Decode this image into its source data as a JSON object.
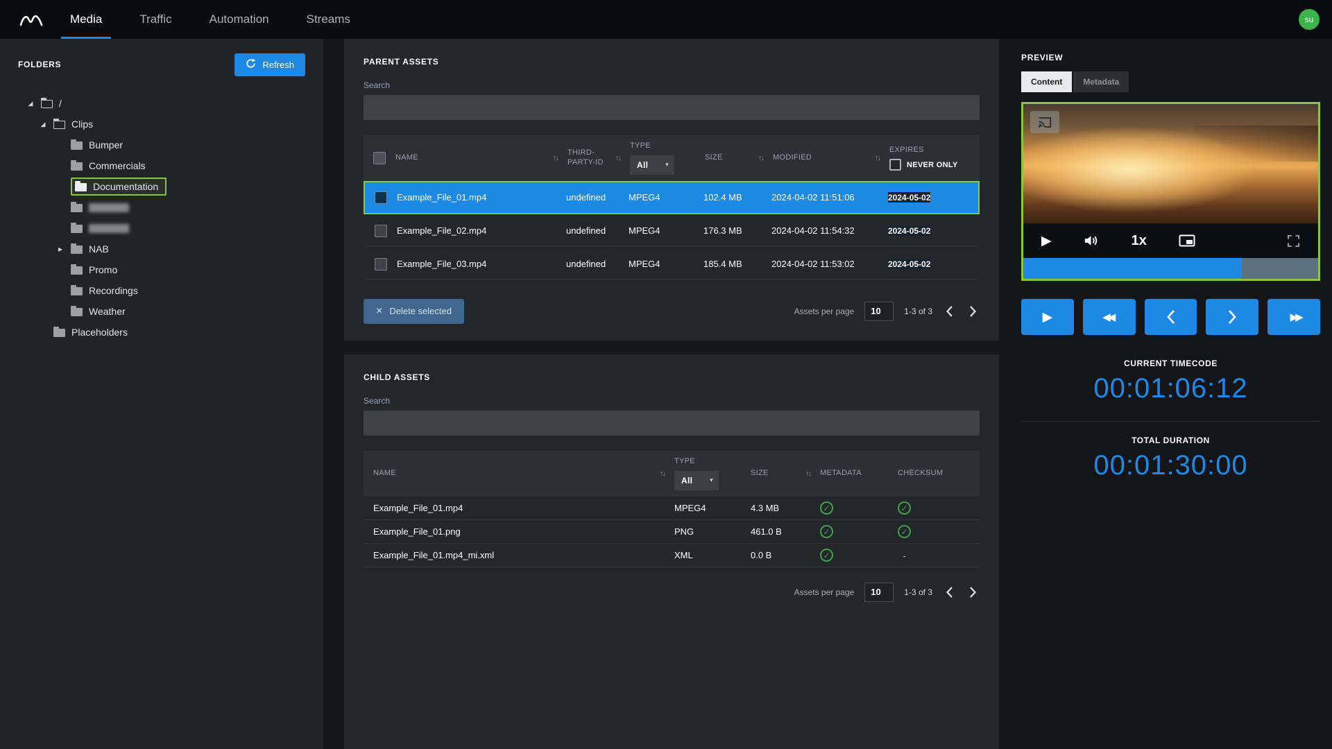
{
  "colors": {
    "accent": "#1e88e5",
    "highlight_green": "#8cc63f",
    "success_green": "#43a047",
    "avatar_green": "#3bb54a"
  },
  "icons": {
    "sort": "↑↓",
    "caret_expanded": "◢",
    "caret_collapsed": "▸",
    "select_caret": "▾",
    "close": "×",
    "play": "▶",
    "rewind": "◀◀",
    "fast_forward": "▶▶"
  },
  "nav": {
    "tabs": [
      {
        "label": "Media",
        "active": true
      },
      {
        "label": "Traffic",
        "active": false
      },
      {
        "label": "Automation",
        "active": false
      },
      {
        "label": "Streams",
        "active": false
      }
    ],
    "avatar_initials": "su"
  },
  "folders": {
    "title": "FOLDERS",
    "refresh_label": "Refresh",
    "tree": [
      {
        "label": "/",
        "level": 0,
        "state": "expanded"
      },
      {
        "label": "Clips",
        "level": 1,
        "state": "expanded"
      },
      {
        "label": "Bumper",
        "level": 2
      },
      {
        "label": "Commercials",
        "level": 2
      },
      {
        "label": "Documentation",
        "level": 2,
        "selected": true
      },
      {
        "label": "",
        "level": 2,
        "redacted": true
      },
      {
        "label": "",
        "level": 2,
        "redacted": true
      },
      {
        "label": "NAB",
        "level": 2,
        "state": "collapsed"
      },
      {
        "label": "Promo",
        "level": 2
      },
      {
        "label": "Recordings",
        "level": 2
      },
      {
        "label": "Weather",
        "level": 2
      },
      {
        "label": "Placeholders",
        "level": 1
      }
    ]
  },
  "parent_assets": {
    "title": "PARENT ASSETS",
    "search_label": "Search",
    "search_value": "",
    "columns": {
      "name": "NAME",
      "third_party_id": "THIRD-PARTY-ID",
      "type": "TYPE",
      "type_filter": "All",
      "size": "SIZE",
      "modified": "MODIFIED",
      "expires": "EXPIRES",
      "never_only": "NEVER ONLY"
    },
    "rows": [
      {
        "name": "Example_File_01.mp4",
        "third_party_id": "undefined",
        "type": "MPEG4",
        "size": "102.4 MB",
        "modified": "2024-04-02 11:51:06",
        "expires": "2024-05-02",
        "selected": true
      },
      {
        "name": "Example_File_02.mp4",
        "third_party_id": "undefined",
        "type": "MPEG4",
        "size": "176.3 MB",
        "modified": "2024-04-02 11:54:32",
        "expires": "2024-05-02",
        "selected": false
      },
      {
        "name": "Example_File_03.mp4",
        "third_party_id": "undefined",
        "type": "MPEG4",
        "size": "185.4 MB",
        "modified": "2024-04-02 11:53:02",
        "expires": "2024-05-02",
        "selected": false
      }
    ],
    "footer": {
      "delete_label": "Delete selected",
      "per_page_label": "Assets per page",
      "per_page_value": "10",
      "range": "1-3 of 3"
    }
  },
  "child_assets": {
    "title": "CHILD ASSETS",
    "search_label": "Search",
    "search_value": "",
    "columns": {
      "name": "NAME",
      "type": "TYPE",
      "type_filter": "All",
      "size": "SIZE",
      "metadata": "METADATA",
      "checksum": "CHECKSUM"
    },
    "rows": [
      {
        "name": "Example_File_01.mp4",
        "type": "MPEG4",
        "size": "4.3 MB",
        "metadata": "check",
        "checksum": "check"
      },
      {
        "name": "Example_File_01.png",
        "type": "PNG",
        "size": "461.0 B",
        "metadata": "check",
        "checksum": "check"
      },
      {
        "name": "Example_File_01.mp4_mi.xml",
        "type": "XML",
        "size": "0.0 B",
        "metadata": "check",
        "checksum": "dash"
      }
    ],
    "footer": {
      "per_page_label": "Assets per page",
      "per_page_value": "10",
      "range": "1-3 of 3"
    }
  },
  "preview": {
    "title": "PREVIEW",
    "tabs": [
      {
        "label": "Content",
        "active": true
      },
      {
        "label": "Metadata",
        "active": false
      }
    ],
    "player": {
      "speed": "1x",
      "progress_percent": 74
    },
    "current_timecode_label": "CURRENT TIMECODE",
    "current_timecode": "00:01:06:12",
    "total_duration_label": "TOTAL DURATION",
    "total_duration": "00:01:30:00"
  }
}
